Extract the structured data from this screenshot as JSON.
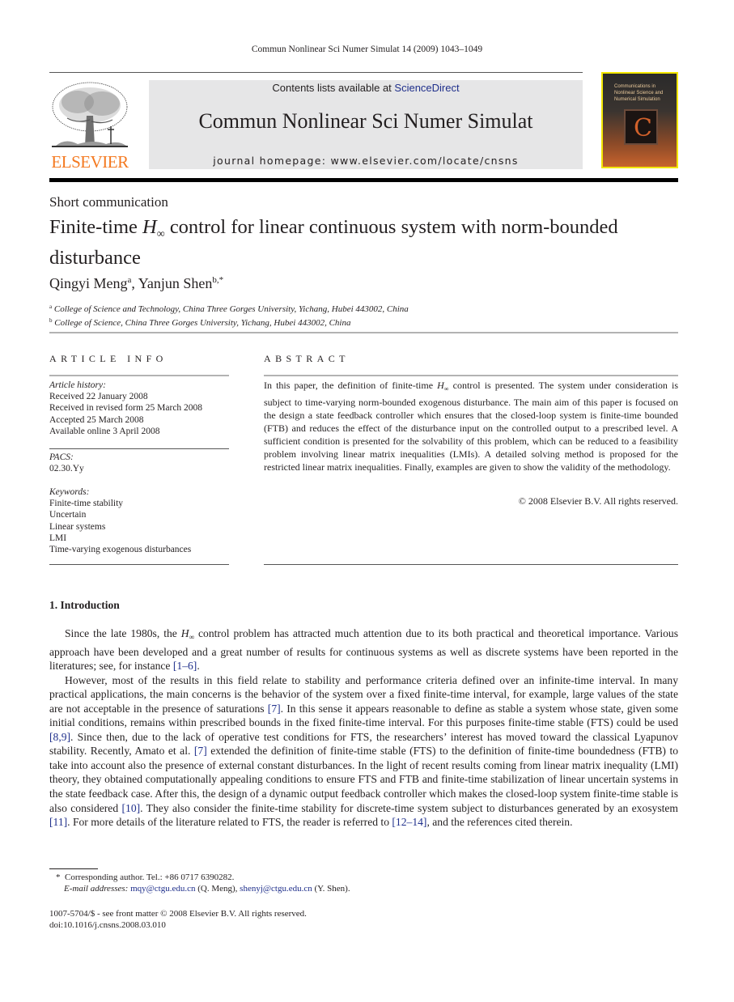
{
  "running_head": "Commun Nonlinear Sci Numer Simulat 14 (2009) 1043–1049",
  "header": {
    "publisher_logo_text": "ELSEVIER",
    "contents_prefix": "Contents lists available at ",
    "contents_link": "ScienceDirect",
    "journal_title": "Commun Nonlinear Sci Numer Simulat",
    "homepage": "journal homepage: www.elsevier.com/locate/cnsns",
    "cover_title": "Communications in Nonlinear Science and Numerical Simulation",
    "brand_color": "#f47920",
    "link_color": "#1f2f8b"
  },
  "article": {
    "type": "Short communication",
    "title_prefix": "Finite-time ",
    "title_symbol": "H",
    "title_subscript": "∞",
    "title_suffix": " control for linear continuous system with norm-bounded disturbance",
    "authors": [
      {
        "name": "Qingyi Meng",
        "sup": "a"
      },
      {
        "name": "Yanjun Shen",
        "sup": "b,*"
      }
    ],
    "affiliations": [
      {
        "sup": "a",
        "text": "College of Science and Technology, China Three Gorges University, Yichang, Hubei 443002, China"
      },
      {
        "sup": "b",
        "text": "College of Science, China Three Gorges University, Yichang, Hubei 443002, China"
      }
    ]
  },
  "article_info": {
    "heading": "ARTICLE INFO",
    "history_label": "Article history:",
    "history": [
      "Received 22 January 2008",
      "Received in revised form 25 March 2008",
      "Accepted 25 March 2008",
      "Available online 3 April 2008"
    ],
    "pacs_label": "PACS:",
    "pacs": "02.30.Yy",
    "keywords_label": "Keywords:",
    "keywords": [
      "Finite-time stability",
      "Uncertain",
      "Linear systems",
      "LMI",
      "Time-varying exogenous disturbances"
    ]
  },
  "abstract": {
    "heading": "ABSTRACT",
    "text_before_symbol": "In this paper, the definition of finite-time ",
    "text_after_symbol": " control is presented. The system under consideration is subject to time-varying norm-bounded exogenous disturbance. The main aim of this paper is focused on the design a state feedback controller which ensures that the closed-loop system is finite-time bounded (FTB) and reduces the effect of the disturbance input on the controlled output to a prescribed level. A sufficient condition is presented for the solvability of this problem, which can be reduced to a feasibility problem involving linear matrix inequalities (LMIs). A detailed solving method is proposed for the restricted linear matrix inequalities. Finally, examples are given to show the validity of the methodology.",
    "copyright": "© 2008 Elsevier B.V. All rights reserved."
  },
  "introduction": {
    "heading": "1.  Introduction",
    "p1_a": "Since the late 1980s, the ",
    "p1_b": " control problem has attracted much attention due to its both practical and theoretical importance. Various approach have been developed and a great number of results for continuous systems as well as discrete systems have been reported in the literatures; see, for instance ",
    "p1_cite": "[1–6]",
    "p1_end": ".",
    "p2_a": "However, most of the results in this field relate to stability and performance criteria defined over an infinite-time interval. In many practical applications, the main concerns is the behavior of the system over a fixed finite-time interval, for example, large values of the state are not acceptable in the presence of saturations ",
    "p2_cite1": "[7]",
    "p2_b": ". In this sense it appears reasonable to define as stable a system whose state, given some initial conditions, remains within prescribed bounds in the fixed finite-time interval. For this purposes finite-time stable (FTS) could be used ",
    "p2_cite2": "[8,9]",
    "p2_c": ". Since then, due to the lack of operative test conditions for FTS, the researchers’ interest has moved toward the classical Lyapunov stability. Recently, Amato et al. ",
    "p2_cite3": "[7]",
    "p2_d": " extended the definition of finite-time stable (FTS) to the definition of finite-time boundedness (FTB) to take into account also the presence of external constant disturbances. In the light of recent results coming from linear matrix inequality (LMI) theory, they obtained computationally appealing conditions to ensure FTS and FTB and finite-time stabilization of linear uncertain systems in the state feedback case. After this, the design of a dynamic output feedback controller which makes the closed-loop system finite-time stable is also considered ",
    "p2_cite4": "[10]",
    "p2_e": ". They also consider the finite-time stability for discrete-time system subject to disturbances generated by an exosystem ",
    "p2_cite5": "[11]",
    "p2_f": ". For more details of the literature related to FTS, the reader is referred to ",
    "p2_cite6": "[12–14]",
    "p2_g": ", and the references cited therein."
  },
  "footnote": {
    "marker": "*",
    "corresponding": "Corresponding author. Tel.: +86 0717 6390282.",
    "email_label": "E-mail addresses:",
    "email1": "mqy@ctgu.edu.cn",
    "email1_owner": " (Q. Meng), ",
    "email2": "shenyj@ctgu.edu.cn",
    "email2_owner": " (Y. Shen)."
  },
  "issn_line": "1007-5704/$ - see front matter © 2008 Elsevier B.V. All rights reserved.",
  "doi": "doi:10.1016/j.cnsns.2008.03.010"
}
